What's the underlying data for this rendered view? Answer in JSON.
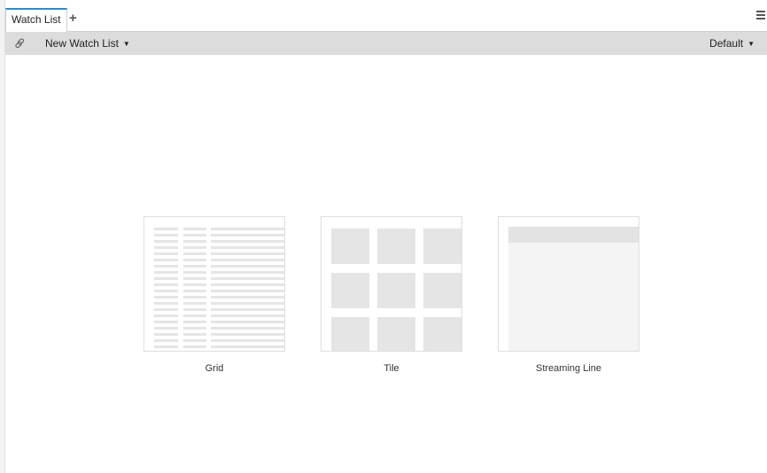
{
  "tabs": {
    "active_label": "Watch List",
    "add_symbol": "+"
  },
  "toolbar": {
    "watchlist_label": "New Watch List",
    "view_label": "Default"
  },
  "icons": {
    "link": "link-icon",
    "menu": "hamburger-menu-icon",
    "caret": "caret-down-icon"
  },
  "layouts": {
    "grid_label": "Grid",
    "tile_label": "Tile",
    "streaming_label": "Streaming Line"
  },
  "colors": {
    "active_tab_accent": "#2a8bd1",
    "toolbar_bg": "#dcdcdc",
    "placeholder_gray": "#e5e5e5"
  }
}
